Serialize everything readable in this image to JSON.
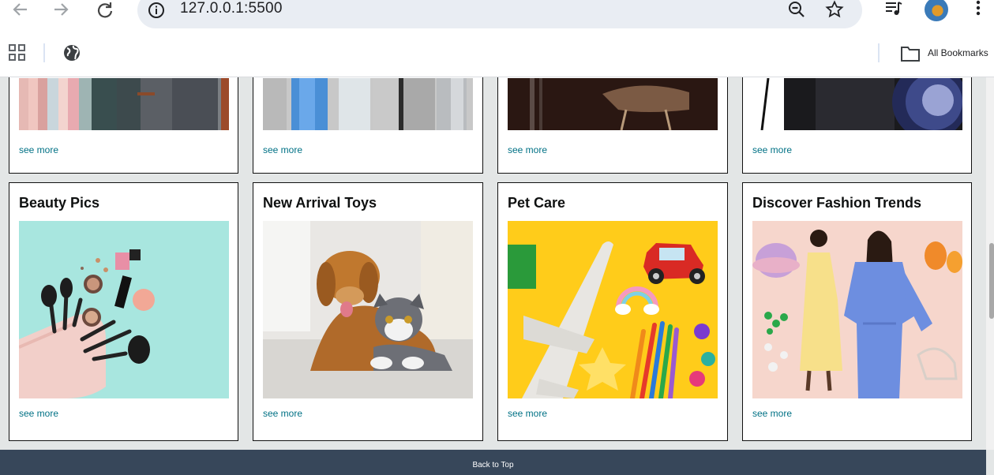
{
  "browser": {
    "url": "127.0.0.1:5500",
    "all_bookmarks_label": "All Bookmarks"
  },
  "top_row": {
    "see_more": [
      "see more",
      "see more",
      "see more",
      "see more"
    ]
  },
  "cards": [
    {
      "title": "Beauty Pics",
      "see_more": "see more",
      "image": "makeup-brushes-and-cosmetics"
    },
    {
      "title": "New Arrival Toys",
      "see_more": "see more",
      "image": "golden-retriever-and-gray-cat"
    },
    {
      "title": "Pet Care",
      "see_more": "see more",
      "image": "toy-plane-car-and-pencils"
    },
    {
      "title": "Discover Fashion Trends",
      "see_more": "see more",
      "image": "models-and-accessories"
    }
  ],
  "footer": {
    "back_to_top": "Back to Top"
  },
  "colors": {
    "link": "#007185",
    "footer": "#37475a",
    "page_bg": "#e3e6e6"
  }
}
